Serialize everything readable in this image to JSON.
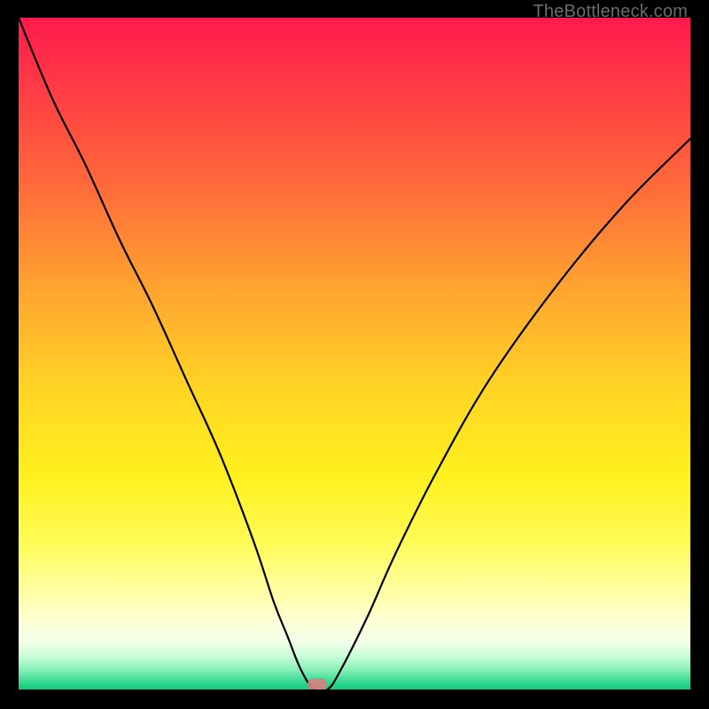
{
  "watermark": "TheBottleneck.com",
  "marker": {
    "x_frac": 0.445,
    "y_frac": 0.995
  },
  "chart_data": {
    "type": "line",
    "title": "",
    "xlabel": "",
    "ylabel": "",
    "xlim": [
      0,
      1
    ],
    "ylim": [
      0,
      1
    ],
    "note": "Axes are normalized to the visible plot area (0..1). The curve shows bottleneck percentage dipping to ~0 near x≈0.44 then rising again.",
    "series": [
      {
        "name": "bottleneck-curve",
        "x": [
          0.0,
          0.05,
          0.1,
          0.15,
          0.2,
          0.25,
          0.3,
          0.35,
          0.38,
          0.4,
          0.42,
          0.44,
          0.46,
          0.48,
          0.52,
          0.56,
          0.62,
          0.7,
          0.8,
          0.9,
          1.0
        ],
        "values": [
          1.0,
          0.88,
          0.78,
          0.67,
          0.57,
          0.46,
          0.35,
          0.22,
          0.13,
          0.08,
          0.03,
          0.0,
          0.0,
          0.03,
          0.11,
          0.2,
          0.32,
          0.46,
          0.6,
          0.72,
          0.82
        ]
      }
    ]
  }
}
